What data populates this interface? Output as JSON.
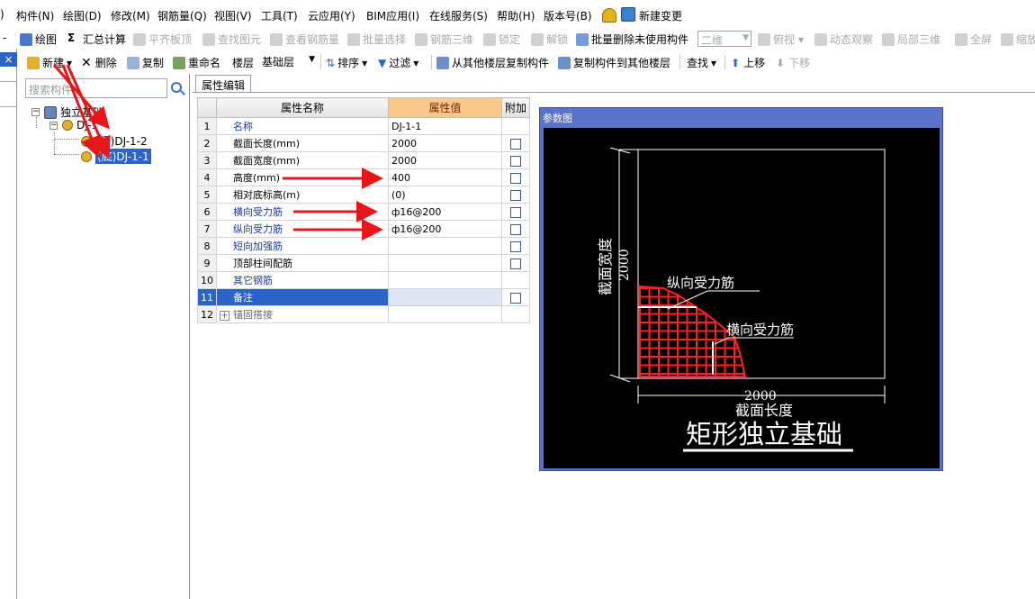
{
  "menubar": {
    "items": [
      "构件(N)",
      "绘图(D)",
      "修改(M)",
      "钢筋量(Q)",
      "视图(V)",
      "工具(T)",
      "云应用(Y)",
      "BIM应用(I)",
      "在线服务(S)",
      "帮助(H)",
      "版本号(B)",
      "新建变更"
    ],
    "partial_left": ")"
  },
  "toolbar1": {
    "draw": "绘图",
    "sigma": "Σ",
    "calc": "汇总计算",
    "flush_slab": "平齐板顶",
    "find_elem": "查找图元",
    "view_rebar": "查看钢筋量",
    "batch_select": "批量选择",
    "rebar_3d": "钢筋三维",
    "lock": "锁定",
    "unlock": "解锁",
    "batch_delete": "批量删除未使用构件",
    "view_mode": "二维",
    "top_view": "俯视",
    "dyn_observe": "动态观察",
    "local_3d": "局部三维",
    "fullscreen": "全屏",
    "zoom_out": "缩放"
  },
  "toolbar2": {
    "new": "新建",
    "delete": "删除",
    "copy": "复制",
    "rename": "重命名",
    "floor_label": "楼层",
    "floor_value": "基础层",
    "sort": "排序",
    "filter": "过滤",
    "copy_from_floor": "从其他楼层复制构件",
    "copy_to_floor": "复制构件到其他楼层",
    "find": "查找",
    "move_up": "上移",
    "move_down": "下移"
  },
  "left_strip": {
    "close": "×"
  },
  "tree": {
    "search_placeholder": "搜索构件...",
    "root": "独立基础",
    "parent": "DJ-1",
    "children": [
      "(顶)DJ-1-2",
      "(底)DJ-1-1"
    ]
  },
  "property_tab": "属性编辑",
  "grid": {
    "headers": [
      "",
      "属性名称",
      "属性值",
      "附加"
    ],
    "rows": [
      {
        "num": "1",
        "name": "名称",
        "value": "DJ-1-1",
        "check": false
      },
      {
        "num": "2",
        "name": "截面长度(mm)",
        "value": "2000",
        "check": true
      },
      {
        "num": "3",
        "name": "截面宽度(mm)",
        "value": "2000",
        "check": true
      },
      {
        "num": "4",
        "name": "高度(mm)",
        "value": "400",
        "check": true
      },
      {
        "num": "5",
        "name": "相对底标高(m)",
        "value": "(0)",
        "check": true
      },
      {
        "num": "6",
        "name": "横向受力筋",
        "value": "ф16@200",
        "check": true
      },
      {
        "num": "7",
        "name": "纵向受力筋",
        "value": "ф16@200",
        "check": true
      },
      {
        "num": "8",
        "name": "短向加强筋",
        "value": "",
        "check": true
      },
      {
        "num": "9",
        "name": "顶部柱间配筋",
        "value": "",
        "check": true
      },
      {
        "num": "10",
        "name": "其它钢筋",
        "value": "",
        "check": false
      },
      {
        "num": "11",
        "name": "备注",
        "value": "",
        "check": true
      },
      {
        "num": "12",
        "name": "锚固搭接",
        "value": "",
        "check": false
      }
    ]
  },
  "reference": {
    "title": "参数图",
    "width_label": "截面宽度",
    "width_value": "2000",
    "length_label": "截面长度",
    "length_value": "2000",
    "long_rebar": "纵向受力筋",
    "trans_rebar": "横向受力筋",
    "caption": "矩形独立基础"
  },
  "colors": {
    "selection": "#2b63c9",
    "annotation_arrow": "#e8161a",
    "value_header": "#f7c88a",
    "rebar_mesh": "#ff2020",
    "cad_background": "#000000"
  }
}
